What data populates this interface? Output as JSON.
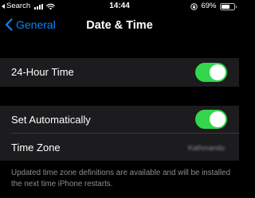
{
  "status_bar": {
    "carrier": "Search",
    "time": "14:44",
    "battery_percent": "69%",
    "battery_level": 0.69,
    "signal_icon": "cellular-signal-icon",
    "wifi_icon": "wifi-icon",
    "lock_icon": "orientation-lock-icon",
    "battery_icon": "battery-icon"
  },
  "nav": {
    "back_label": "General",
    "back_icon": "chevron-left-icon",
    "title": "Date & Time"
  },
  "settings": {
    "hour24": {
      "label": "24-Hour Time",
      "enabled": true
    },
    "set_automatically": {
      "label": "Set Automatically",
      "enabled": true
    },
    "time_zone": {
      "label": "Time Zone",
      "value": "Kathmandu"
    },
    "footnote": "Updated time zone definitions are available and will be installed the next time iPhone restarts."
  },
  "colors": {
    "background": "#000000",
    "row_background": "#1c1c1e",
    "accent": "#0a84ff",
    "toggle_on": "#32d74b",
    "secondary_text": "#8e8e93"
  }
}
